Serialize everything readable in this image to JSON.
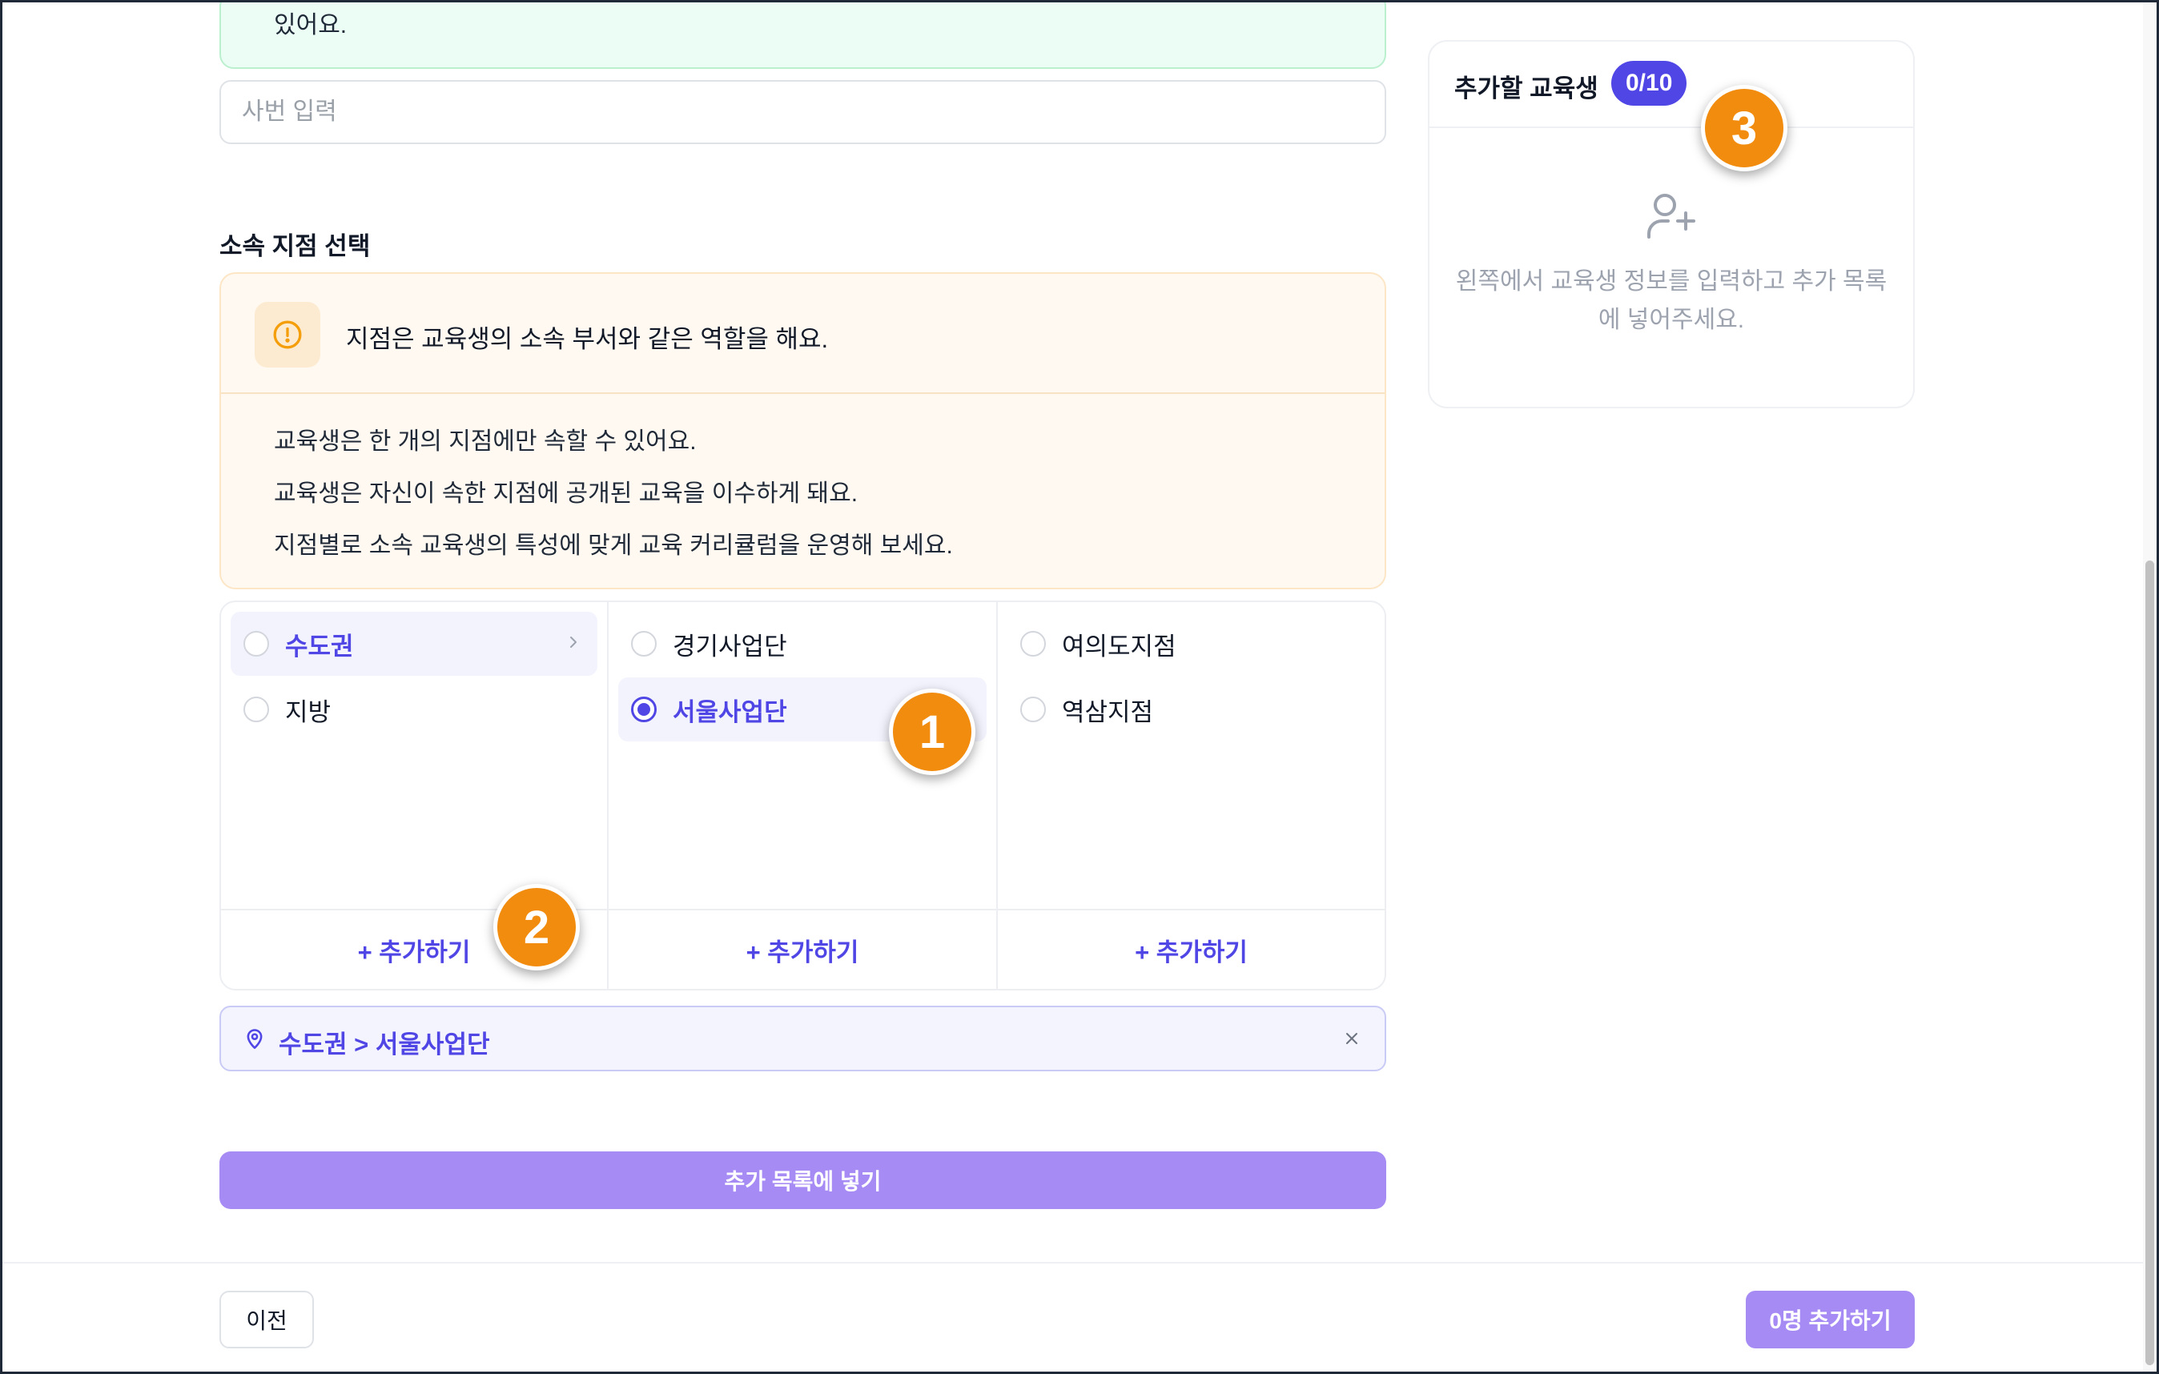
{
  "top_notice": {
    "text": "있어요."
  },
  "employee_id_input": {
    "placeholder": "사번 입력",
    "value": ""
  },
  "branch_section": {
    "title": "소속 지점 선택",
    "info": {
      "icon": "alert-circle-icon",
      "heading": "지점은 교육생의 소속 부서와 같은 역할을 해요.",
      "lines": [
        "교육생은 한 개의 지점에만 속할 수 있어요.",
        "교육생은 자신이 속한 지점에 공개된 교육을 이수하게 돼요.",
        "지점별로 소속 교육생의 특성에 맞게 교육 커리큘럼을 운영해 보세요."
      ]
    },
    "columns": [
      {
        "options": [
          {
            "label": "수도권",
            "state": "expanded"
          },
          {
            "label": "지방",
            "state": "none"
          }
        ],
        "add_label": "+ 추가하기"
      },
      {
        "options": [
          {
            "label": "경기사업단",
            "state": "none"
          },
          {
            "label": "서울사업단",
            "state": "selected"
          }
        ],
        "add_label": "+ 추가하기"
      },
      {
        "options": [
          {
            "label": "여의도지점",
            "state": "none"
          },
          {
            "label": "역삼지점",
            "state": "none"
          }
        ],
        "add_label": "+ 추가하기"
      }
    ],
    "selected_path": "수도권 > 서울사업단"
  },
  "add_to_list_button": "추가 목록에 넣기",
  "right_panel": {
    "title": "추가할 교육생",
    "count_badge": "0/10",
    "empty_icon": "user-plus-icon",
    "empty_text": "왼쪽에서 교육생 정보를 입력하고 추가 목록에 넣어주세요."
  },
  "footer": {
    "prev_button": "이전",
    "submit_button": "0명 추가하기"
  },
  "annotations": [
    "1",
    "2",
    "3"
  ],
  "colors": {
    "accent": "#4f46e5",
    "button_light_purple": "#a78bf4",
    "marker_orange": "#f28c0f",
    "notice_green": "#ecfdf5",
    "info_bg": "#fff9f1"
  }
}
